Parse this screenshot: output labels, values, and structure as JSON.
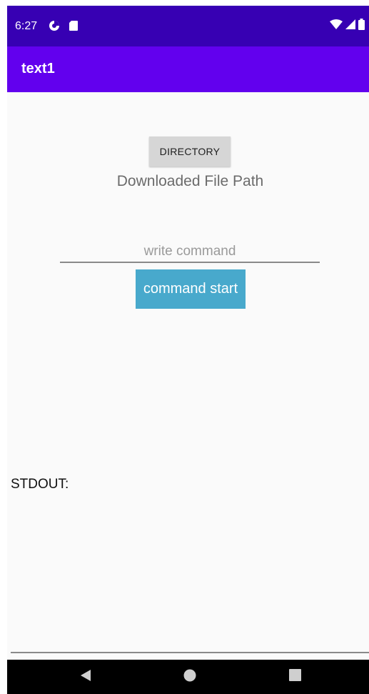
{
  "status_bar": {
    "time": "6:27",
    "left_icons": [
      "data-saver-icon",
      "sd-card-icon"
    ],
    "right_icons": [
      "wifi-icon",
      "signal-icon",
      "battery-icon"
    ]
  },
  "app_bar": {
    "title": "text1"
  },
  "main": {
    "directory_button_label": "DIRECTORY",
    "file_path_text": "Downloaded File Path",
    "command_input": {
      "value": "",
      "placeholder": "write command"
    },
    "command_button_label": "command start",
    "stdout_label": "STDOUT:"
  },
  "nav_bar": {
    "buttons": [
      "back-icon",
      "home-icon",
      "recents-icon"
    ]
  },
  "colors": {
    "status_bar": "#3700b3",
    "app_bar": "#6200ee",
    "command_button": "#48a9cc",
    "directory_button": "#d6d6d6"
  }
}
